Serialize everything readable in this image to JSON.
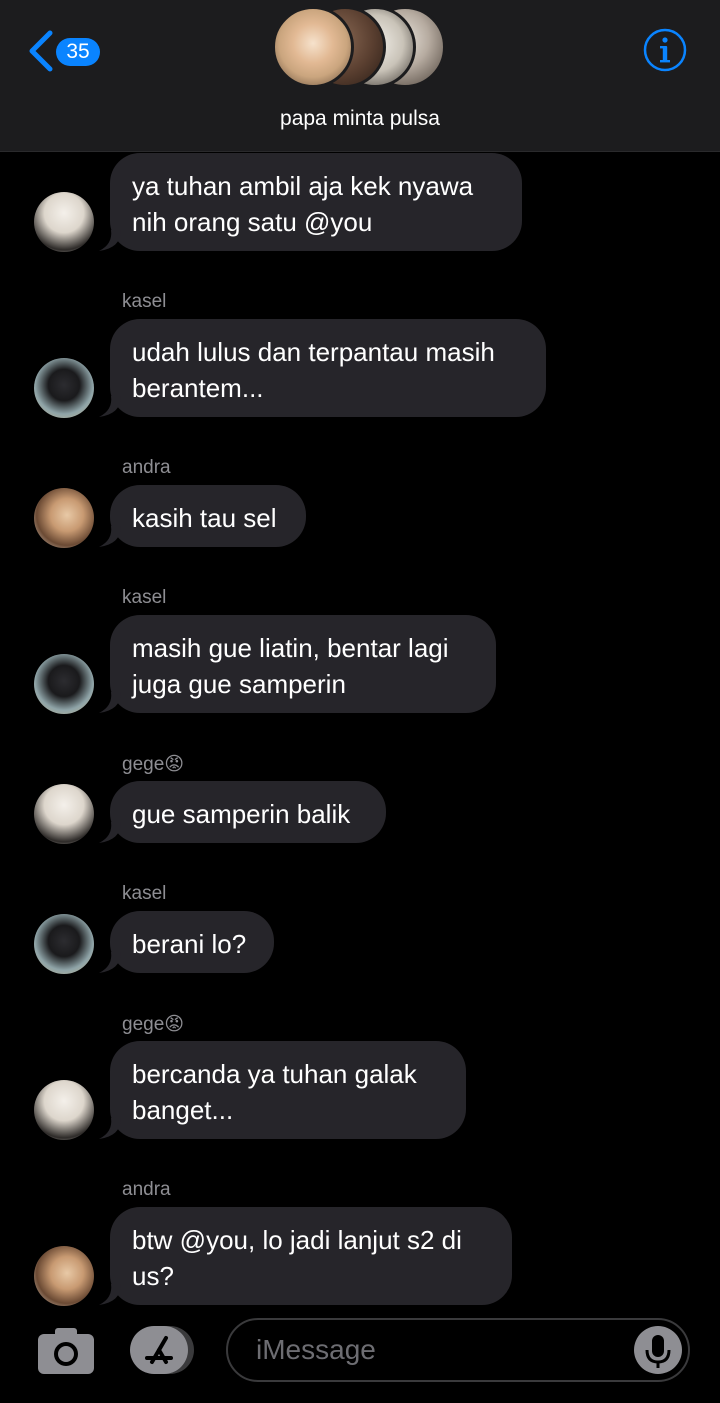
{
  "header": {
    "back_count": "35",
    "group_name": "papa minta pulsa"
  },
  "input": {
    "placeholder": "iMessage"
  },
  "messages": [
    {
      "sender": "",
      "text_lines": [
        "ya tuhan ambil aja kek nyawa",
        "nih orang satu @you"
      ],
      "avatar": "gege"
    },
    {
      "sender": "kasel",
      "text_lines": [
        "udah lulus dan terpantau masih",
        "berantem..."
      ],
      "avatar": "kasel"
    },
    {
      "sender": "andra",
      "text_lines": [
        "kasih tau sel"
      ],
      "avatar": "andra"
    },
    {
      "sender": "kasel",
      "text_lines": [
        "masih gue liatin, bentar lagi",
        "juga gue samperin"
      ],
      "avatar": "kasel"
    },
    {
      "sender": "gege😡",
      "text_lines": [
        "gue samperin balik"
      ],
      "avatar": "gege"
    },
    {
      "sender": "kasel",
      "text_lines": [
        "berani lo?"
      ],
      "avatar": "kasel"
    },
    {
      "sender": "gege😡",
      "text_lines": [
        "bercanda ya tuhan galak",
        "banget..."
      ],
      "avatar": "gege"
    },
    {
      "sender": "andra",
      "text_lines": [
        "btw @you, lo jadi lanjut s2 di",
        "us?"
      ],
      "avatar": "andra"
    }
  ],
  "colors": {
    "accent": "#0a84ff",
    "bubble": "#26252a",
    "background": "#000000",
    "sender_label": "#8e8e93"
  },
  "icons": {
    "back": "chevron-left-icon",
    "info": "info-icon",
    "camera": "camera-icon",
    "apps": "app-store-icon",
    "mic": "microphone-icon"
  }
}
